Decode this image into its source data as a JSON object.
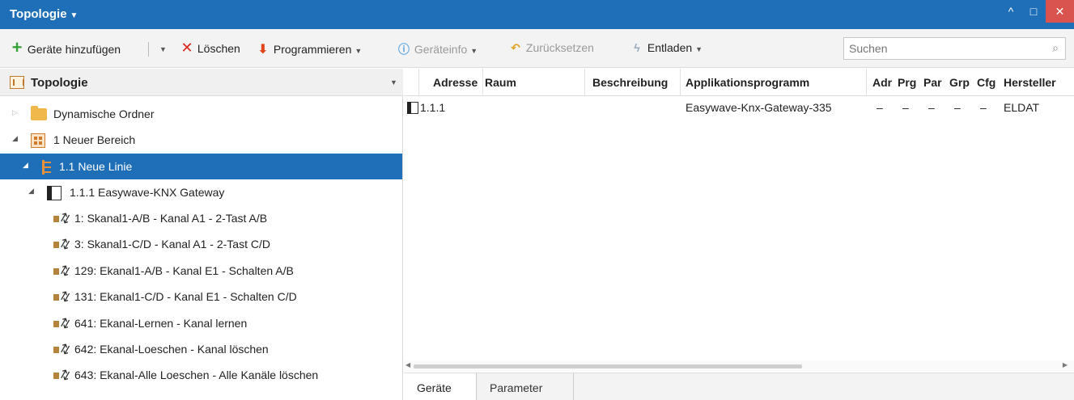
{
  "window": {
    "title": "Topologie",
    "buttons": {
      "up": "^",
      "maximize": "□",
      "close": "✕"
    }
  },
  "toolbar": {
    "add_devices": "Geräte hinzufügen",
    "delete": "Löschen",
    "program": "Programmieren",
    "device_info": "Geräteinfo",
    "reset": "Zurücksetzen",
    "unload": "Entladen",
    "search_placeholder": "Suchen"
  },
  "left_panel": {
    "header": "Topologie",
    "tree": [
      {
        "label": "Dynamische Ordner",
        "icon": "folder-icon"
      },
      {
        "label": "1 Neuer Bereich",
        "icon": "area-icon"
      },
      {
        "label": "1.1 Neue Linie",
        "icon": "line-icon",
        "selected": true
      },
      {
        "label": "1.1.1 Easywave-KNX Gateway",
        "icon": "device-icon"
      },
      {
        "label": "1: Skanal1-A/B - Kanal A1 - 2-Tast A/B",
        "icon": "group-object-icon"
      },
      {
        "label": "3: Skanal1-C/D - Kanal A1 - 2-Tast C/D",
        "icon": "group-object-icon"
      },
      {
        "label": "129: Ekanal1-A/B - Kanal E1 - Schalten A/B",
        "icon": "group-object-icon"
      },
      {
        "label": "131: Ekanal1-C/D - Kanal E1 - Schalten C/D",
        "icon": "group-object-icon"
      },
      {
        "label": "641: Ekanal-Lernen - Kanal lernen",
        "icon": "group-object-icon"
      },
      {
        "label": "642: Ekanal-Loeschen - Kanal löschen",
        "icon": "group-object-icon"
      },
      {
        "label": "643: Ekanal-Alle Loeschen - Alle Kanäle löschen",
        "icon": "group-object-icon"
      }
    ]
  },
  "grid": {
    "columns": [
      "Adresse",
      "Raum",
      "Beschreibung",
      "Applikationsprogramm",
      "Adr",
      "Prg",
      "Par",
      "Grp",
      "Cfg",
      "Hersteller"
    ],
    "rows": [
      {
        "address": "1.1.1",
        "room": "",
        "description": "",
        "application": "Easywave-Knx-Gateway-335",
        "adr": "–",
        "prg": "–",
        "par": "–",
        "grp": "–",
        "cfg": "–",
        "manufacturer": "ELDAT"
      }
    ]
  },
  "tabs": [
    "Geräte",
    "Parameter"
  ],
  "colors": {
    "accent": "#1e6fb7",
    "close": "#d9534f"
  }
}
